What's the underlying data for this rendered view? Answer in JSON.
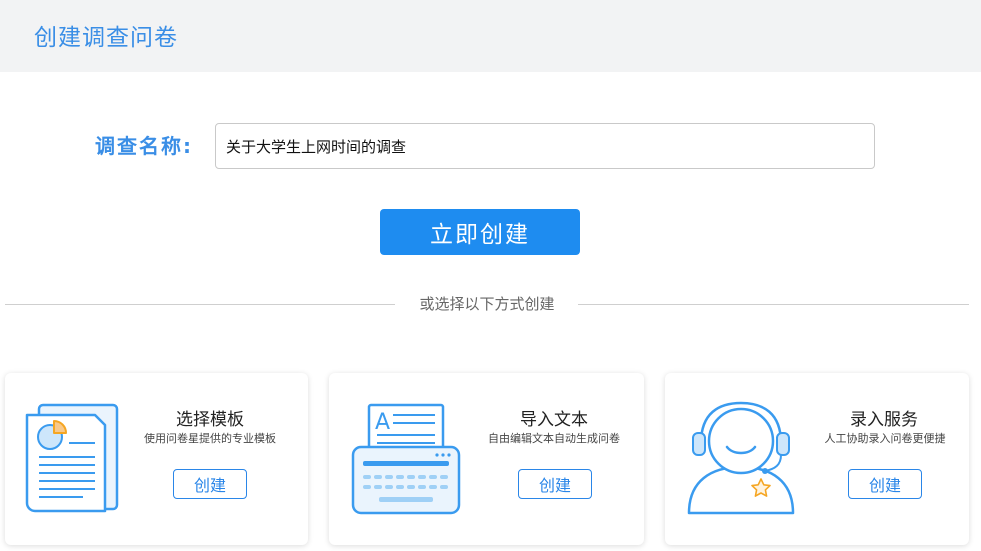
{
  "header": {
    "title": "创建调查问卷"
  },
  "form": {
    "name_label": "调查名称:",
    "name_value": "关于大学生上网时间的调查"
  },
  "create_button": {
    "label": "立即创建"
  },
  "divider": {
    "text": "或选择以下方式创建"
  },
  "cards": [
    {
      "title": "选择模板",
      "description": "使用问卷星提供的专业模板",
      "button": "创建",
      "icon": "template-document-icon"
    },
    {
      "title": "导入文本",
      "description": "自由编辑文本自动生成问卷",
      "button": "创建",
      "icon": "typewriter-import-icon"
    },
    {
      "title": "录入服务",
      "description": "人工协助录入问卷更便捷",
      "button": "创建",
      "icon": "customer-service-headset-icon"
    }
  ],
  "colors": {
    "accent": "#1e8cf0",
    "label_blue": "#3a8ee6",
    "header_bg": "#f2f3f4",
    "icon_blue": "#3a9bef",
    "icon_orange": "#f5a623"
  }
}
